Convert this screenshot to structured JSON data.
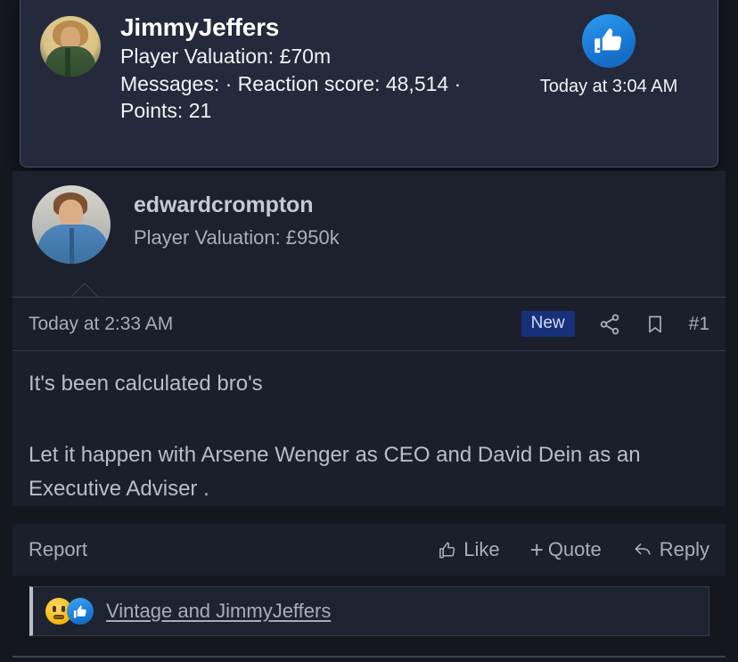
{
  "member_card": {
    "username": "JimmyJeffers",
    "valuation": "Player Valuation: £70m",
    "stats_line": "Messages:  ·  Reaction score: 48,514  ·",
    "points": "Points: 21",
    "timestamp": "Today at 3:04 AM",
    "badge_icon": "thumbs-up-icon",
    "avatar_alt": "JimmyJeffers avatar",
    "accent": "#1877d2",
    "bg": "#242a3b",
    "border": "#454f68"
  },
  "post": {
    "author": {
      "username": "edwardcrompton",
      "valuation": "Player Valuation: £950k",
      "avatar_alt": "edwardcrompton avatar"
    },
    "meta": {
      "date": "Today at 2:33 AM",
      "new_badge": "New",
      "share_icon": "share-icon",
      "bookmark_icon": "bookmark-icon",
      "post_number": "#1",
      "new_badge_bg": "#16307a"
    },
    "body": {
      "paragraph_1": "It's been calculated bro's",
      "paragraph_2": "Let it happen with Arsene Wenger as CEO and David Dein as an Executive Adviser ."
    },
    "actions": {
      "report": "Report",
      "like": "Like",
      "like_icon": "thumbs-up-outline-icon",
      "quote": "Quote",
      "quote_icon": "plus-icon",
      "quote_plus": "+",
      "reply": "Reply",
      "reply_icon": "reply-arrow-icon"
    },
    "reactions": {
      "emoji_1": "confused-face-icon",
      "emoji_2": "thumbs-up-icon",
      "names": "Vintage and JimmyJeffers"
    }
  },
  "theme": {
    "page_bg": "#15171f",
    "post_bg": "#1b1f2b",
    "header_bg": "#1d212e",
    "text_primary": "#b8bec9",
    "text_muted": "#a7aeba",
    "divider": "#3a4153"
  }
}
